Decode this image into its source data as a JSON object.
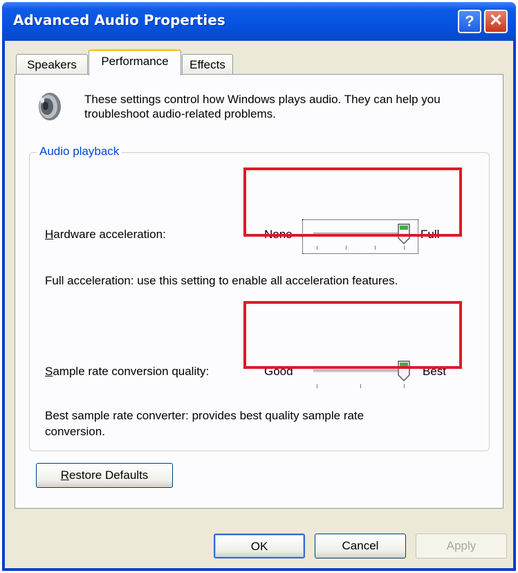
{
  "window": {
    "title": "Advanced Audio Properties",
    "help_glyph": "?",
    "close_glyph": "✕"
  },
  "tabs": [
    {
      "label": "Speakers"
    },
    {
      "label": "Performance"
    },
    {
      "label": "Effects"
    }
  ],
  "intro": {
    "line1": "These settings control how Windows plays audio. They can help you",
    "line2": "troubleshoot audio-related problems.",
    "icon": "speaker-icon"
  },
  "audio_playback": {
    "group_label": "Audio playback",
    "hardware_acceleration": {
      "label_underlined": "H",
      "label_rest": "ardware acceleration:",
      "min_label": "None",
      "max_label": "Full",
      "level": 1.0,
      "tick_count": 4,
      "description": "Full acceleration: use this setting to enable all acceleration features."
    },
    "sample_rate": {
      "label_underlined": "S",
      "label_rest": "ample rate conversion quality:",
      "min_label": "Good",
      "max_label": "Best",
      "level": 1.0,
      "tick_count": 3,
      "description_line1": "Best sample rate converter:  provides best quality sample rate",
      "description_line2": "conversion."
    }
  },
  "buttons": {
    "restore_underlined": "R",
    "restore_rest": "estore Defaults",
    "ok": "OK",
    "cancel": "Cancel",
    "apply": "Apply"
  },
  "colors": {
    "highlight_box": "#e0182a",
    "titlebar": "#0552e0",
    "group_label": "#0046d5"
  }
}
